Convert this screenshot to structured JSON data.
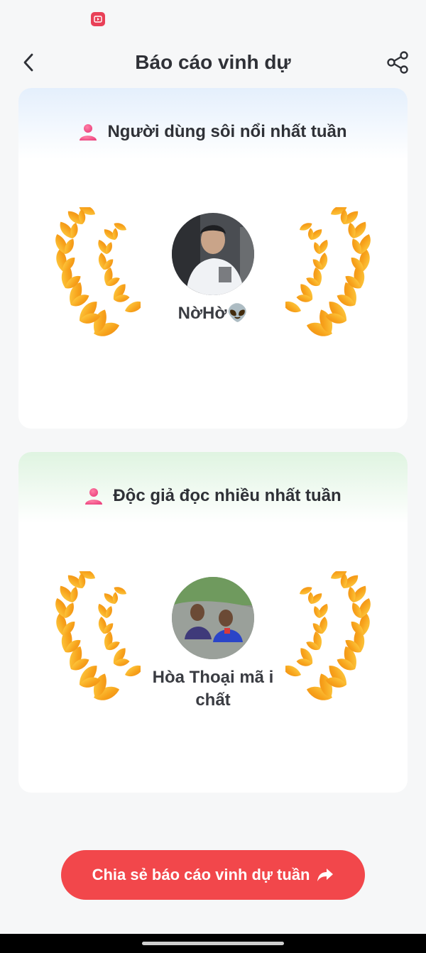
{
  "header": {
    "title": "Báo cáo vinh dự"
  },
  "cards": [
    {
      "title": "Người dùng sôi nổi nhất tuần",
      "user_name": "NờHờ👽"
    },
    {
      "title": "Độc giả đọc nhiều nhất tuần",
      "user_name": "Hòa Thoại mã i chất"
    }
  ],
  "share_report": {
    "label": "Chia sẻ báo cáo vinh dự tuần"
  },
  "icons": {
    "status": "screen-record-icon",
    "back": "chevron-left-icon",
    "share": "share-icon",
    "user": "user-icon",
    "forward": "share-arrow-icon",
    "wreath": "laurel-wreath-icon"
  },
  "colors": {
    "accent": "#f2474b",
    "card1_tint": "#e4effc",
    "card2_tint": "#dff4e1",
    "user_icon": "#f0507c",
    "wreath_gold": "#f5a623"
  }
}
